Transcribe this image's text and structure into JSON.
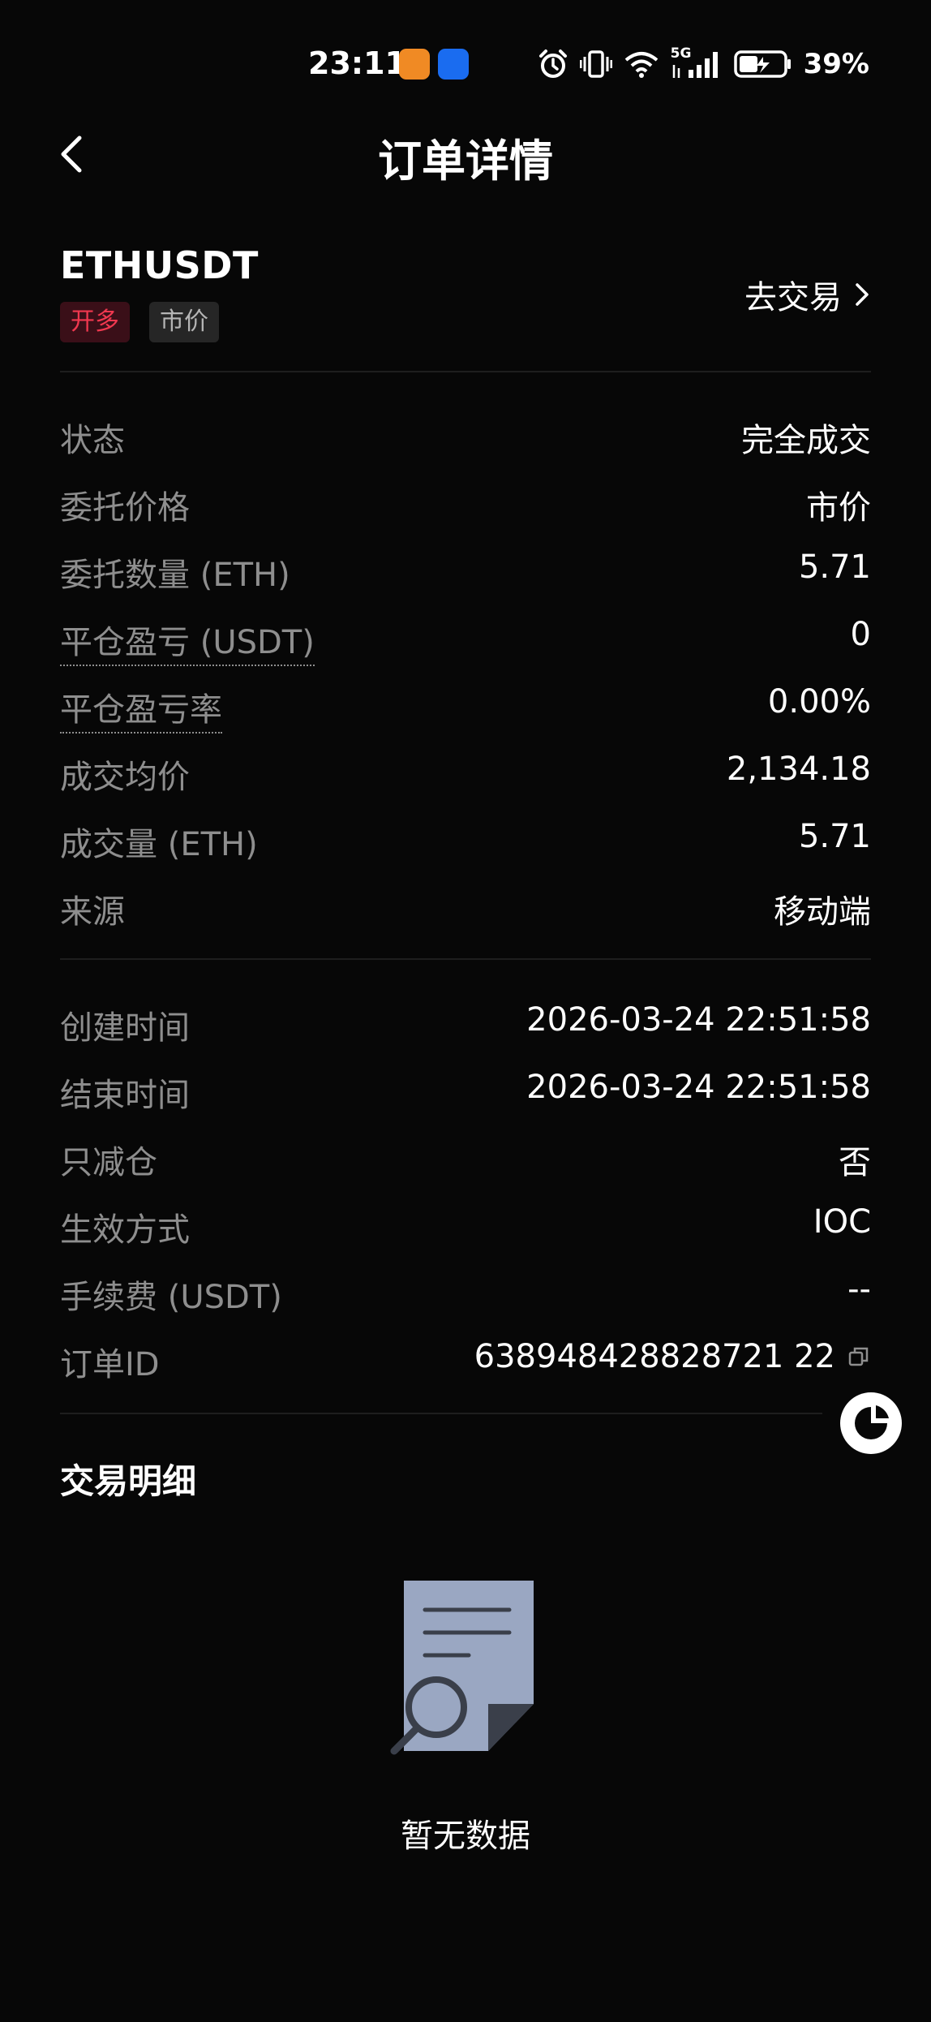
{
  "status_bar": {
    "time": "23:11",
    "network": "5G",
    "battery": "39%"
  },
  "nav": {
    "title": "订单详情"
  },
  "header": {
    "symbol": "ETHUSDT",
    "tag_side": "开多",
    "tag_type": "市价",
    "trade_link": "去交易"
  },
  "details": {
    "status": {
      "label": "状态",
      "value": "完全成交"
    },
    "order_price": {
      "label": "委托价格",
      "value": "市价"
    },
    "order_qty": {
      "label": "委托数量 (ETH)",
      "value": "5.71"
    },
    "close_pnl": {
      "label": "平仓盈亏 (USDT)",
      "value": "0"
    },
    "close_pnl_rate": {
      "label": "平仓盈亏率",
      "value": "0.00%"
    },
    "avg_price": {
      "label": "成交均价",
      "value": "2,134.18"
    },
    "filled_qty": {
      "label": "成交量 (ETH)",
      "value": "5.71"
    },
    "source": {
      "label": "来源",
      "value": "移动端"
    }
  },
  "meta": {
    "created": {
      "label": "创建时间",
      "value": "2026-03-24 22:51:58"
    },
    "ended": {
      "label": "结束时间",
      "value": "2026-03-24 22:51:58"
    },
    "reduce_only": {
      "label": "只减仓",
      "value": "否"
    },
    "time_in_force": {
      "label": "生效方式",
      "value": "IOC"
    },
    "fee": {
      "label": "手续费 (USDT)",
      "value": "--"
    },
    "order_id": {
      "label": "订单ID",
      "value": "638948428828721 22"
    }
  },
  "trade_details": {
    "title": "交易明细",
    "empty_text": "暂无数据"
  },
  "colors": {
    "background": "#070707",
    "long_red": "#f0384f",
    "label_gray": "#8e8e8e"
  },
  "icons": {
    "back": "chevron-left-icon",
    "trade_arrow": "chevron-right-icon",
    "copy": "copy-icon",
    "float": "support-icon",
    "empty": "document-search-icon"
  }
}
